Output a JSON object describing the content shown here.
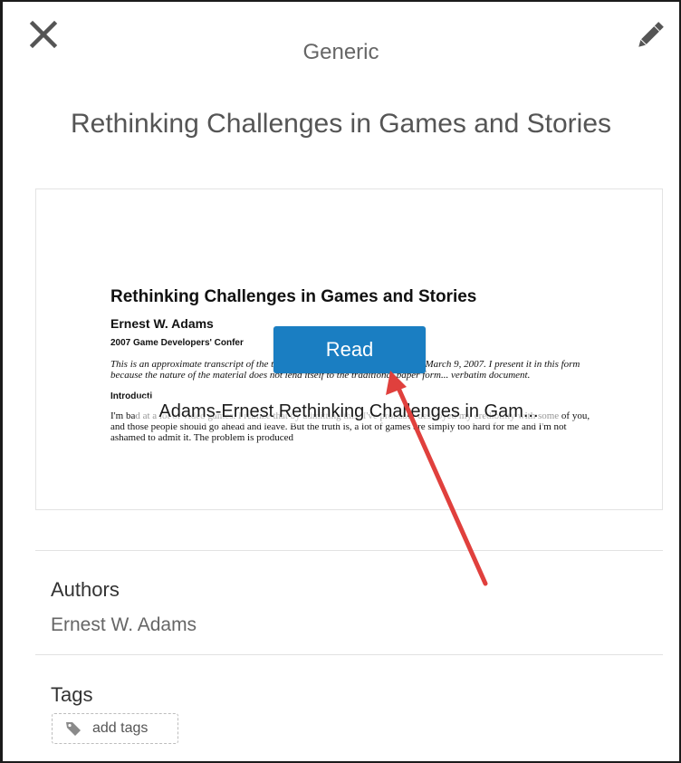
{
  "header": {
    "category": "Generic",
    "title": "Rethinking Challenges in Games and Stories",
    "close_icon": "close-icon",
    "edit_icon": "pencil-icon"
  },
  "preview": {
    "paper_title": "Rethinking Challenges in Games and Stories",
    "paper_author": "Ernest W. Adams",
    "paper_venue": "2007 Game Developers' Confer",
    "paper_abstract": "This is an approximate transcript of the text of my lecture at the 2007 GDC on March 9, 2007. I present it in this form because the nature of the material does not lend itself to the traditional paper form... verbatim document.",
    "paper_section": "Introducti",
    "paper_body": "I'm bad at a lot of video games. I realize that by admitting this, I've probably destroyed my credibility with some of you, and those people should go ahead and leave. But the truth is, a lot of games are simply too hard for me and I'm not ashamed to admit it. The problem is produced",
    "read_label": "Read",
    "file_name": "Adams-Ernest Rethinking Challenges in Gam..."
  },
  "authors": {
    "label": "Authors",
    "value": "Ernest W. Adams"
  },
  "tags": {
    "label": "Tags",
    "add_label": "add tags",
    "tag_icon": "tag-icon"
  },
  "colors": {
    "accent": "#1a7ec2",
    "annotation_arrow": "#e0403d"
  }
}
